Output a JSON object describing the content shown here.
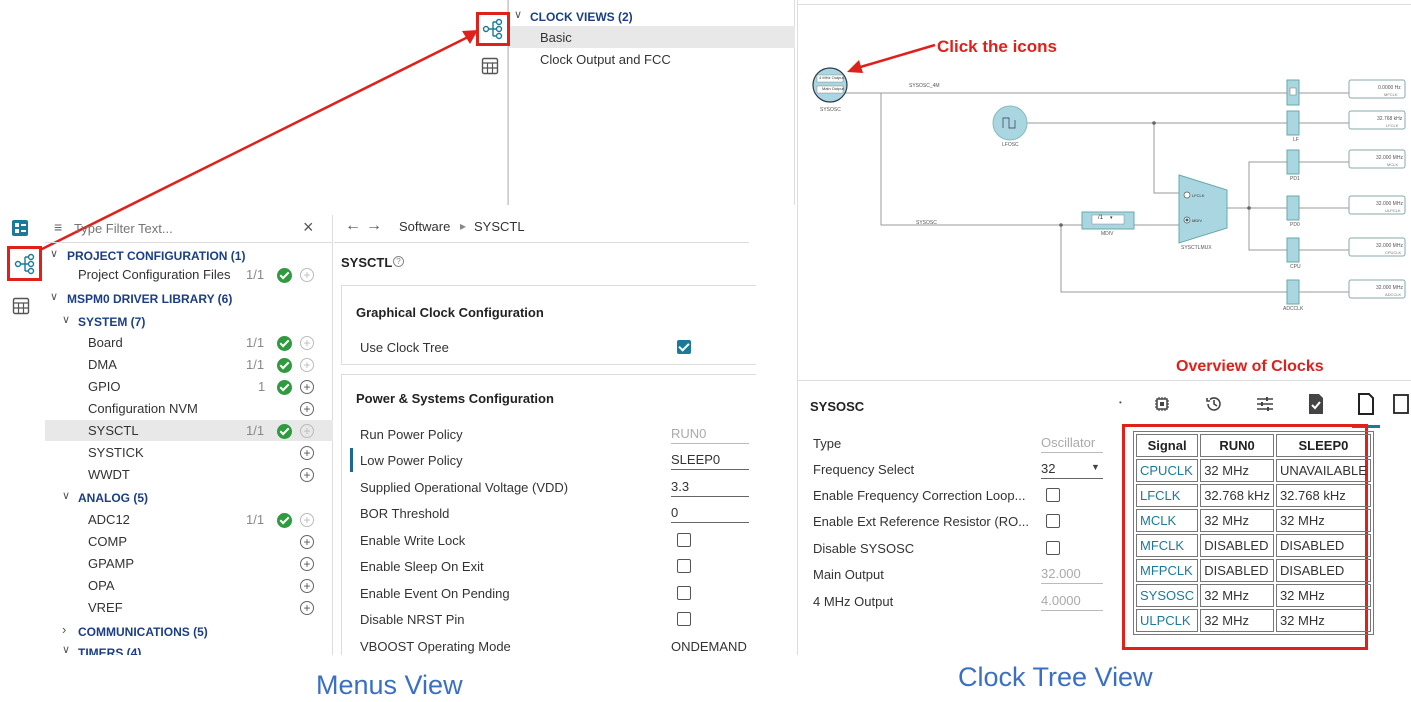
{
  "menus": {
    "clock_views": {
      "header": "CLOCK VIEWS (2)",
      "items": [
        "Basic",
        "Clock Output and FCC"
      ]
    },
    "filter_placeholder": "Type Filter Text...",
    "tree": {
      "project_header": "PROJECT CONFIGURATION (1)",
      "project_file": "Project Configuration Files",
      "project_file_count": "1/1",
      "driver_header": "MSPM0 DRIVER LIBRARY (6)",
      "system_header": "SYSTEM (7)",
      "system_items": [
        {
          "label": "Board",
          "count": "1/1",
          "ok": true
        },
        {
          "label": "DMA",
          "count": "1/1",
          "ok": true
        },
        {
          "label": "GPIO",
          "count": "1",
          "ok": true
        },
        {
          "label": "Configuration NVM",
          "count": "",
          "ok": false
        },
        {
          "label": "SYSCTL",
          "count": "1/1",
          "ok": true
        },
        {
          "label": "SYSTICK",
          "count": "",
          "ok": false
        },
        {
          "label": "WWDT",
          "count": "",
          "ok": false
        }
      ],
      "analog_header": "ANALOG (5)",
      "analog_items": [
        {
          "label": "ADC12",
          "count": "1/1",
          "ok": true
        },
        {
          "label": "COMP",
          "count": "",
          "ok": false
        },
        {
          "label": "GPAMP",
          "count": "",
          "ok": false
        },
        {
          "label": "OPA",
          "count": "",
          "ok": false
        },
        {
          "label": "VREF",
          "count": "",
          "ok": false
        }
      ],
      "communications_header": "COMMUNICATIONS (5)",
      "timers_header": "TIMERS (4)"
    },
    "breadcrumb": {
      "root": "Software",
      "leaf": "SYSCTL"
    },
    "module_title": "SYSCTL",
    "graphical_section": {
      "title": "Graphical Clock Configuration",
      "use_clock_tree": "Use Clock Tree"
    },
    "power_section": {
      "title": "Power & Systems Configuration",
      "run_power_policy": {
        "label": "Run Power Policy",
        "value": "RUN0"
      },
      "low_power_policy": {
        "label": "Low Power Policy",
        "value": "SLEEP0"
      },
      "vdd": {
        "label": "Supplied Operational Voltage (VDD)",
        "value": "3.3"
      },
      "bor": {
        "label": "BOR Threshold",
        "value": "0"
      },
      "write_lock": "Enable Write Lock",
      "sleep_on_exit": "Enable Sleep On Exit",
      "event_on_pending": "Enable Event On Pending",
      "disable_nrst": "Disable NRST Pin",
      "vboost": {
        "label": "VBOOST Operating Mode",
        "value": "ONDEMAND"
      }
    },
    "caption": "Menus View"
  },
  "clock_tree": {
    "annotation_icons": "Click the icons",
    "annotation_overview": "Overview of Clocks",
    "diagram": {
      "sysosc_node": {
        "line1": "4 MHz Output",
        "line2": "Main Output",
        "label": "SYSOSC"
      },
      "lfosc_label": "LFOSC",
      "mdiv_value": "/1",
      "mdiv_label": "MDIV",
      "mux_label": "SYSCTLMUX",
      "mux_in1": "LFCLK",
      "mux_in2": "MDIV",
      "wire_sysosc_4m": "SYSOSC_4M",
      "wire_sysosc": "SYSOSC",
      "gates": [
        "LF",
        "PD1",
        "PD0",
        "CPU",
        "ADCCLK"
      ],
      "outputs": [
        {
          "freq": "0.0000 Hz",
          "name": "MFCLK"
        },
        {
          "freq": "32.768 kHz",
          "name": "LFCLK"
        },
        {
          "freq": "32.000 MHz",
          "name": "MCLK"
        },
        {
          "freq": "32.000 MHz",
          "name": "ULPCLK"
        },
        {
          "freq": "32.000 MHz",
          "name": "CPUCLK"
        },
        {
          "freq": "32.000 MHz",
          "name": "ADCCLK"
        }
      ]
    },
    "props": {
      "title": "SYSOSC",
      "type": {
        "label": "Type",
        "value": "Oscillator"
      },
      "freq_select": {
        "label": "Frequency Select",
        "value": "32"
      },
      "fcl": "Enable Frequency Correction Loop...",
      "rosc": "Enable Ext Reference Resistor (RO...",
      "disable": "Disable SYSOSC",
      "main_output": {
        "label": "Main Output",
        "value": "32.000 MH"
      },
      "out4": {
        "label": "4 MHz Output",
        "value": "4.0000 MH;"
      }
    },
    "table": {
      "headers": [
        "Signal",
        "RUN0",
        "SLEEP0"
      ],
      "rows": [
        [
          "CPUCLK",
          "32 MHz",
          "UNAVAILABLE"
        ],
        [
          "LFCLK",
          "32.768 kHz",
          "32.768 kHz"
        ],
        [
          "MCLK",
          "32 MHz",
          "32 MHz"
        ],
        [
          "MFCLK",
          "DISABLED",
          "DISABLED"
        ],
        [
          "MFPCLK",
          "DISABLED",
          "DISABLED"
        ],
        [
          "SYSOSC",
          "32 MHz",
          "32 MHz"
        ],
        [
          "ULPCLK",
          "32 MHz",
          "32 MHz"
        ]
      ]
    },
    "caption": "Clock Tree View"
  },
  "colors": {
    "accent": "#1b7a9a",
    "annotation": "#e0201b",
    "caption": "#3a6fc4",
    "header": "#1b3e86"
  }
}
